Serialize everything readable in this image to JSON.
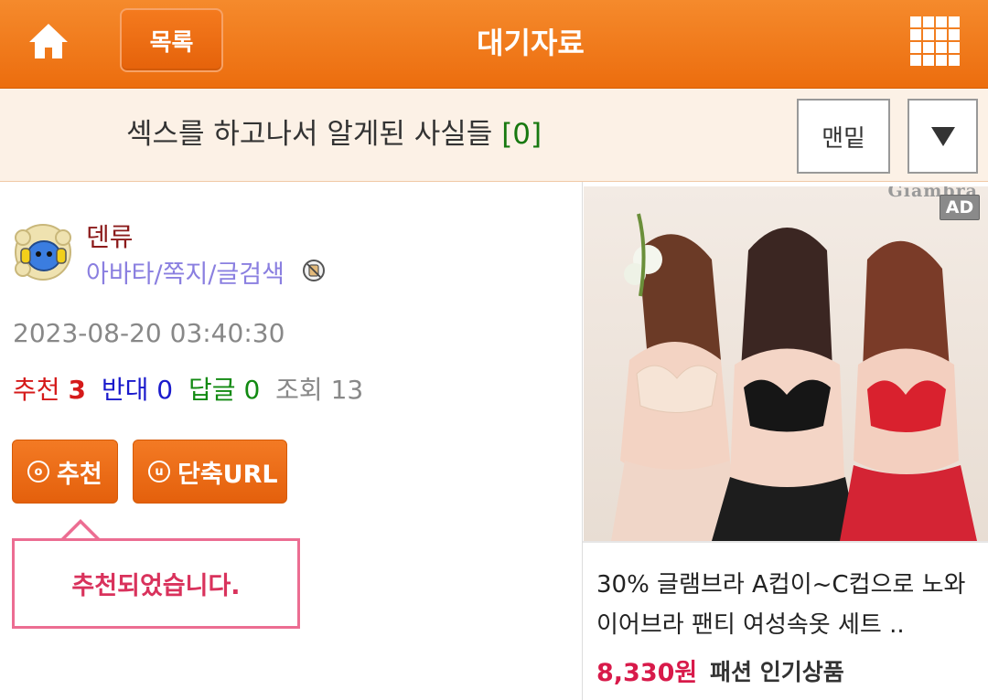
{
  "header": {
    "home_icon": "home-icon",
    "list_label": "목록",
    "title": "대기자료",
    "menu_icon": "grid-menu-icon",
    "color": "#ec6d0e"
  },
  "post": {
    "subject": "섹스를 하고나서 알게된 사실들",
    "comment_count": "[0]",
    "bottom_label": "맨밑",
    "down_icon": "triangle-down-icon"
  },
  "author": {
    "name": "덴류",
    "links": "아바타/쪽지/글검색",
    "datetime": "2023-08-20 03:40:30"
  },
  "stats": {
    "recommend_label": "추천",
    "recommend_value": "3",
    "oppose_label": "반대",
    "oppose_value": "0",
    "reply_label": "답글",
    "reply_value": "0",
    "views_label": "조회",
    "views_value": "13"
  },
  "actions": {
    "recommend_badge": "o",
    "recommend_label": "추천",
    "url_badge": "u",
    "url_label": "단축URL"
  },
  "tooltip": {
    "message": "추천되었습니다."
  },
  "ad": {
    "brand": "Giambra",
    "badge": "AD",
    "description": "30% 글램브라 A컵이~C컵으로 노와이어브라 팬티 여성속옷 세트 ..",
    "price": "8,330원",
    "category": "패션 인기상품"
  }
}
